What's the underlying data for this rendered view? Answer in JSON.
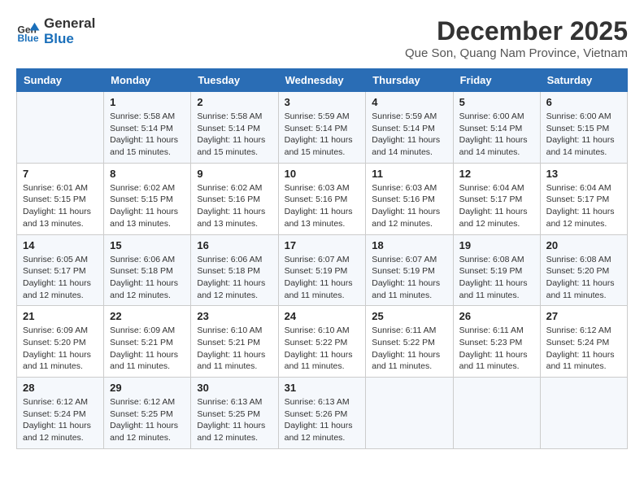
{
  "logo": {
    "line1": "General",
    "line2": "Blue"
  },
  "title": "December 2025",
  "location": "Que Son, Quang Nam Province, Vietnam",
  "days_of_week": [
    "Sunday",
    "Monday",
    "Tuesday",
    "Wednesday",
    "Thursday",
    "Friday",
    "Saturday"
  ],
  "weeks": [
    [
      {
        "day": "",
        "sunrise": "",
        "sunset": "",
        "daylight": ""
      },
      {
        "day": "1",
        "sunrise": "Sunrise: 5:58 AM",
        "sunset": "Sunset: 5:14 PM",
        "daylight": "Daylight: 11 hours and 15 minutes."
      },
      {
        "day": "2",
        "sunrise": "Sunrise: 5:58 AM",
        "sunset": "Sunset: 5:14 PM",
        "daylight": "Daylight: 11 hours and 15 minutes."
      },
      {
        "day": "3",
        "sunrise": "Sunrise: 5:59 AM",
        "sunset": "Sunset: 5:14 PM",
        "daylight": "Daylight: 11 hours and 15 minutes."
      },
      {
        "day": "4",
        "sunrise": "Sunrise: 5:59 AM",
        "sunset": "Sunset: 5:14 PM",
        "daylight": "Daylight: 11 hours and 14 minutes."
      },
      {
        "day": "5",
        "sunrise": "Sunrise: 6:00 AM",
        "sunset": "Sunset: 5:14 PM",
        "daylight": "Daylight: 11 hours and 14 minutes."
      },
      {
        "day": "6",
        "sunrise": "Sunrise: 6:00 AM",
        "sunset": "Sunset: 5:15 PM",
        "daylight": "Daylight: 11 hours and 14 minutes."
      }
    ],
    [
      {
        "day": "7",
        "sunrise": "Sunrise: 6:01 AM",
        "sunset": "Sunset: 5:15 PM",
        "daylight": "Daylight: 11 hours and 13 minutes."
      },
      {
        "day": "8",
        "sunrise": "Sunrise: 6:02 AM",
        "sunset": "Sunset: 5:15 PM",
        "daylight": "Daylight: 11 hours and 13 minutes."
      },
      {
        "day": "9",
        "sunrise": "Sunrise: 6:02 AM",
        "sunset": "Sunset: 5:16 PM",
        "daylight": "Daylight: 11 hours and 13 minutes."
      },
      {
        "day": "10",
        "sunrise": "Sunrise: 6:03 AM",
        "sunset": "Sunset: 5:16 PM",
        "daylight": "Daylight: 11 hours and 13 minutes."
      },
      {
        "day": "11",
        "sunrise": "Sunrise: 6:03 AM",
        "sunset": "Sunset: 5:16 PM",
        "daylight": "Daylight: 11 hours and 12 minutes."
      },
      {
        "day": "12",
        "sunrise": "Sunrise: 6:04 AM",
        "sunset": "Sunset: 5:17 PM",
        "daylight": "Daylight: 11 hours and 12 minutes."
      },
      {
        "day": "13",
        "sunrise": "Sunrise: 6:04 AM",
        "sunset": "Sunset: 5:17 PM",
        "daylight": "Daylight: 11 hours and 12 minutes."
      }
    ],
    [
      {
        "day": "14",
        "sunrise": "Sunrise: 6:05 AM",
        "sunset": "Sunset: 5:17 PM",
        "daylight": "Daylight: 11 hours and 12 minutes."
      },
      {
        "day": "15",
        "sunrise": "Sunrise: 6:06 AM",
        "sunset": "Sunset: 5:18 PM",
        "daylight": "Daylight: 11 hours and 12 minutes."
      },
      {
        "day": "16",
        "sunrise": "Sunrise: 6:06 AM",
        "sunset": "Sunset: 5:18 PM",
        "daylight": "Daylight: 11 hours and 12 minutes."
      },
      {
        "day": "17",
        "sunrise": "Sunrise: 6:07 AM",
        "sunset": "Sunset: 5:19 PM",
        "daylight": "Daylight: 11 hours and 11 minutes."
      },
      {
        "day": "18",
        "sunrise": "Sunrise: 6:07 AM",
        "sunset": "Sunset: 5:19 PM",
        "daylight": "Daylight: 11 hours and 11 minutes."
      },
      {
        "day": "19",
        "sunrise": "Sunrise: 6:08 AM",
        "sunset": "Sunset: 5:19 PM",
        "daylight": "Daylight: 11 hours and 11 minutes."
      },
      {
        "day": "20",
        "sunrise": "Sunrise: 6:08 AM",
        "sunset": "Sunset: 5:20 PM",
        "daylight": "Daylight: 11 hours and 11 minutes."
      }
    ],
    [
      {
        "day": "21",
        "sunrise": "Sunrise: 6:09 AM",
        "sunset": "Sunset: 5:20 PM",
        "daylight": "Daylight: 11 hours and 11 minutes."
      },
      {
        "day": "22",
        "sunrise": "Sunrise: 6:09 AM",
        "sunset": "Sunset: 5:21 PM",
        "daylight": "Daylight: 11 hours and 11 minutes."
      },
      {
        "day": "23",
        "sunrise": "Sunrise: 6:10 AM",
        "sunset": "Sunset: 5:21 PM",
        "daylight": "Daylight: 11 hours and 11 minutes."
      },
      {
        "day": "24",
        "sunrise": "Sunrise: 6:10 AM",
        "sunset": "Sunset: 5:22 PM",
        "daylight": "Daylight: 11 hours and 11 minutes."
      },
      {
        "day": "25",
        "sunrise": "Sunrise: 6:11 AM",
        "sunset": "Sunset: 5:22 PM",
        "daylight": "Daylight: 11 hours and 11 minutes."
      },
      {
        "day": "26",
        "sunrise": "Sunrise: 6:11 AM",
        "sunset": "Sunset: 5:23 PM",
        "daylight": "Daylight: 11 hours and 11 minutes."
      },
      {
        "day": "27",
        "sunrise": "Sunrise: 6:12 AM",
        "sunset": "Sunset: 5:24 PM",
        "daylight": "Daylight: 11 hours and 11 minutes."
      }
    ],
    [
      {
        "day": "28",
        "sunrise": "Sunrise: 6:12 AM",
        "sunset": "Sunset: 5:24 PM",
        "daylight": "Daylight: 11 hours and 12 minutes."
      },
      {
        "day": "29",
        "sunrise": "Sunrise: 6:12 AM",
        "sunset": "Sunset: 5:25 PM",
        "daylight": "Daylight: 11 hours and 12 minutes."
      },
      {
        "day": "30",
        "sunrise": "Sunrise: 6:13 AM",
        "sunset": "Sunset: 5:25 PM",
        "daylight": "Daylight: 11 hours and 12 minutes."
      },
      {
        "day": "31",
        "sunrise": "Sunrise: 6:13 AM",
        "sunset": "Sunset: 5:26 PM",
        "daylight": "Daylight: 11 hours and 12 minutes."
      },
      {
        "day": "",
        "sunrise": "",
        "sunset": "",
        "daylight": ""
      },
      {
        "day": "",
        "sunrise": "",
        "sunset": "",
        "daylight": ""
      },
      {
        "day": "",
        "sunrise": "",
        "sunset": "",
        "daylight": ""
      }
    ]
  ]
}
